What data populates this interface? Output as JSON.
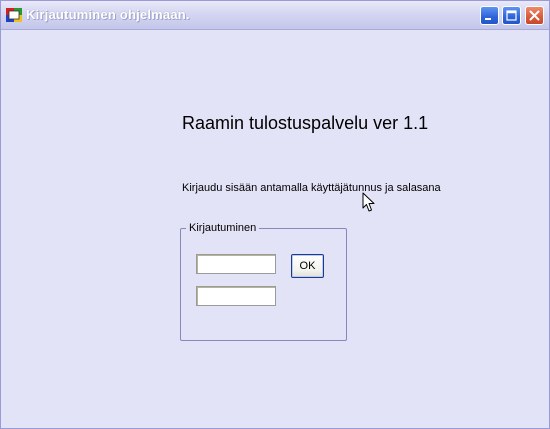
{
  "window": {
    "title": "Kirjautuminen ohjelmaan.",
    "colors": {
      "client_background": "#e3e3f8",
      "titlebar": "#d4d6f2",
      "close_button": "#d85a3a",
      "control_button": "#2f62d9"
    }
  },
  "icons": [
    "app-icon",
    "minimize-icon",
    "maximize-icon",
    "close-icon",
    "mouse-cursor-icon"
  ],
  "main": {
    "title": "Raamin tulostuspalvelu ver 1.1",
    "instruction": "Kirjaudu sisään antamalla käyttäjätunnus ja salasana"
  },
  "login_group": {
    "label": "Kirjautuminen",
    "username_value": "",
    "password_value": "",
    "ok_label": "OK"
  }
}
